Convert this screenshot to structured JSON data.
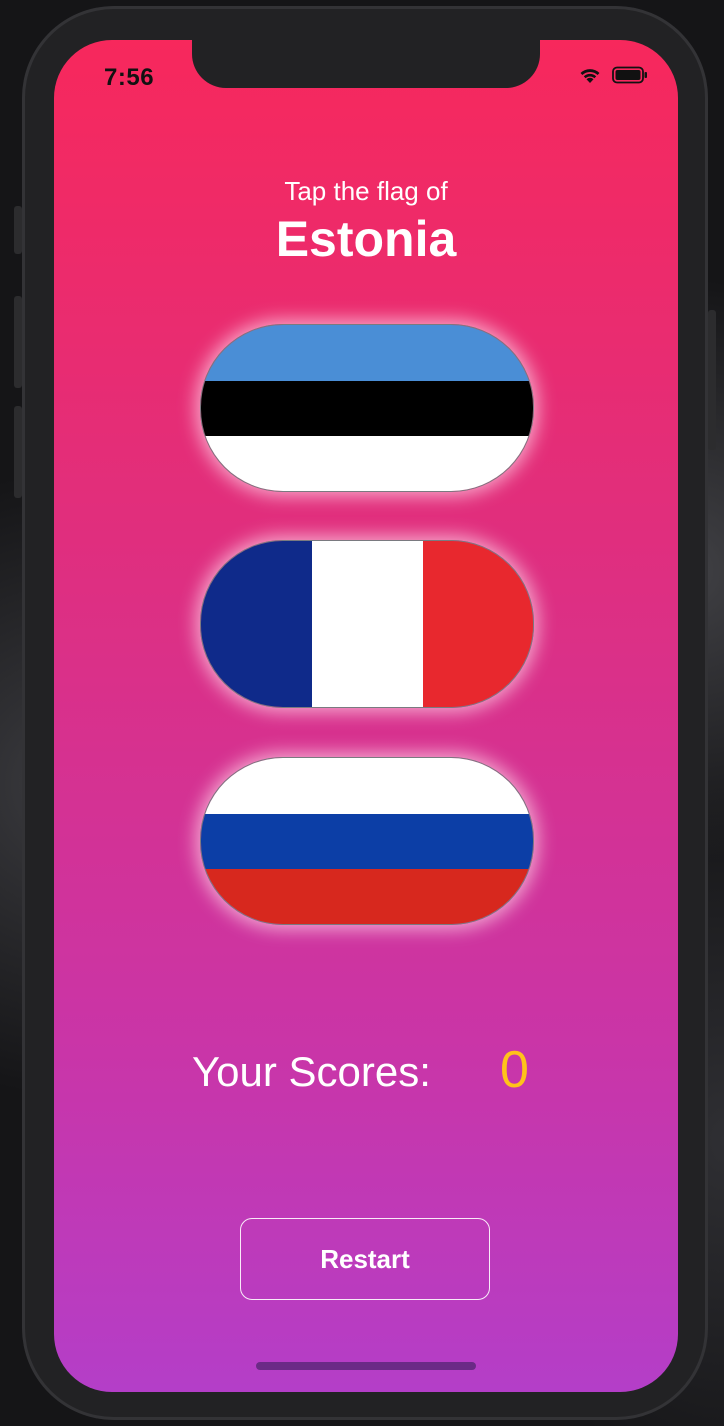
{
  "status_bar": {
    "time": "7:56",
    "icons": [
      "wifi-icon",
      "battery-icon"
    ]
  },
  "game": {
    "prompt": "Tap the flag of",
    "country": "Estonia",
    "flags": [
      {
        "country": "Estonia",
        "colors": [
          "#4a8ed6",
          "#000000",
          "#ffffff"
        ],
        "layout": "horizontal"
      },
      {
        "country": "France",
        "colors": [
          "#0f2a8a",
          "#ffffff",
          "#e8282e"
        ],
        "layout": "vertical"
      },
      {
        "country": "Russia",
        "colors": [
          "#ffffff",
          "#0c3ea6",
          "#d7281e"
        ],
        "layout": "horizontal"
      }
    ]
  },
  "score": {
    "label": "Your Scores:",
    "value": "0"
  },
  "actions": {
    "restart_label": "Restart"
  },
  "colors": {
    "gradient_top": "#f7285c",
    "gradient_bottom": "#b43ec8",
    "score_value": "#ffc21a"
  }
}
